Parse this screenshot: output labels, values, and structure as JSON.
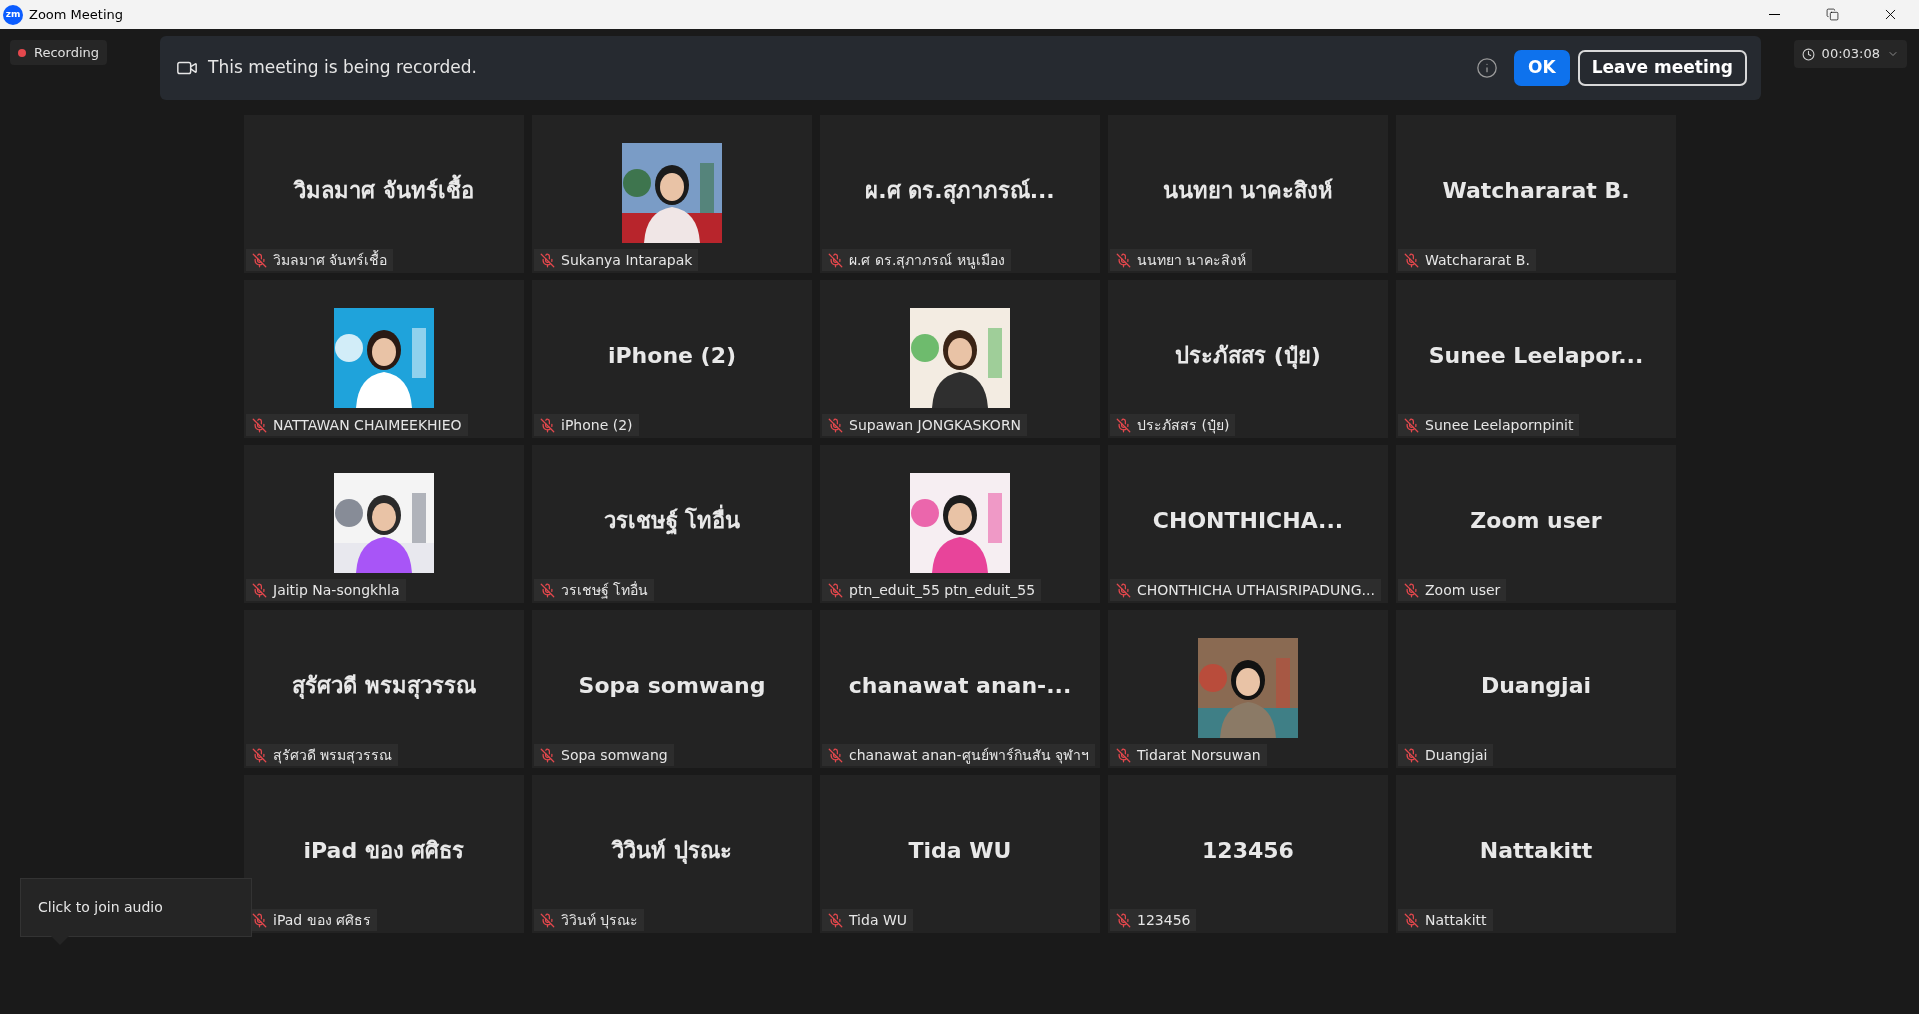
{
  "window": {
    "logo": "zm",
    "title": "Zoom Meeting"
  },
  "recording": {
    "label": "Recording"
  },
  "timer": {
    "value": "00:03:08"
  },
  "banner": {
    "message": "This meeting is being recorded.",
    "ok": "OK",
    "leave": "Leave meeting"
  },
  "tiles": [
    {
      "kind": "name",
      "display": "วิมลมาศ จันทร์เชื้อ",
      "caption": "วิมลมาศ จันทร์เชื้อ",
      "muted": true
    },
    {
      "kind": "picture",
      "caption": "Sukanya Intarapak",
      "muted": true
    },
    {
      "kind": "name",
      "display": "ผ.ศ ดร.สุภาภรณ์...",
      "caption": "ผ.ศ ดร.สุภาภรณ์ หนูเมือง",
      "muted": true
    },
    {
      "kind": "name",
      "display": "นนทยา นาคะสิงห์",
      "caption": "นนทยา นาคะสิงห์",
      "muted": true
    },
    {
      "kind": "name",
      "display": "Watchararat B.",
      "caption": "Watchararat B.",
      "muted": true
    },
    {
      "kind": "picture",
      "caption": "NATTAWAN CHAIMEEKHIEO",
      "muted": true
    },
    {
      "kind": "name",
      "display": "iPhone (2)",
      "caption": "iPhone (2)",
      "muted": true
    },
    {
      "kind": "picture",
      "caption": "Supawan JONGKASKORN",
      "muted": true
    },
    {
      "kind": "name",
      "display": "ประภัสสร (ปุ๋ย)",
      "caption": "ประภัสสร (ปุ๋ย)",
      "muted": true
    },
    {
      "kind": "name",
      "display": "Sunee  Leelapor...",
      "caption": "Sunee Leelapornpinit",
      "muted": true
    },
    {
      "kind": "picture",
      "caption": "Jaitip Na-songkhla",
      "muted": true
    },
    {
      "kind": "name",
      "display": "วรเชษฐ์ โทอื่น",
      "caption": "วรเชษฐ์ โทอื่น",
      "muted": true
    },
    {
      "kind": "picture",
      "caption": "ptn_eduit_55 ptn_eduit_55",
      "muted": true
    },
    {
      "kind": "name",
      "display": "CHONTHICHA...",
      "caption": "CHONTHICHA UTHAISRIPADUNG...",
      "muted": true
    },
    {
      "kind": "name",
      "display": "Zoom user",
      "caption": "Zoom user",
      "muted": true
    },
    {
      "kind": "name",
      "display": "สุรัศวดี พรมสุวรรณ",
      "caption": "สุรัศวดี พรมสุวรรณ",
      "muted": true
    },
    {
      "kind": "name",
      "display": "Sopa somwang",
      "caption": "Sopa somwang",
      "muted": true
    },
    {
      "kind": "name",
      "display": "chanawat  anan-...",
      "caption": "chanawat anan-ศูนย์พาร์กินสัน จุฬาฯ",
      "muted": true
    },
    {
      "kind": "picture",
      "caption": "Tidarat Norsuwan",
      "muted": true
    },
    {
      "kind": "name",
      "display": "Duangjai",
      "caption": "Duangjai",
      "muted": true
    },
    {
      "kind": "name",
      "display": "iPad ของ ศศิธร",
      "caption": "iPad ของ ศศิธร",
      "muted": true
    },
    {
      "kind": "name",
      "display": "วิวินท์ ปุรณะ",
      "caption": "วิวินท์ ปุรณะ",
      "muted": true
    },
    {
      "kind": "name",
      "display": "Tida WU",
      "caption": "Tida WU",
      "muted": true
    },
    {
      "kind": "name",
      "display": "123456",
      "caption": "123456",
      "muted": true
    },
    {
      "kind": "name",
      "display": "Nattakitt",
      "caption": "Nattakitt",
      "muted": true
    }
  ],
  "tooltip": {
    "text": "Click to join audio"
  }
}
